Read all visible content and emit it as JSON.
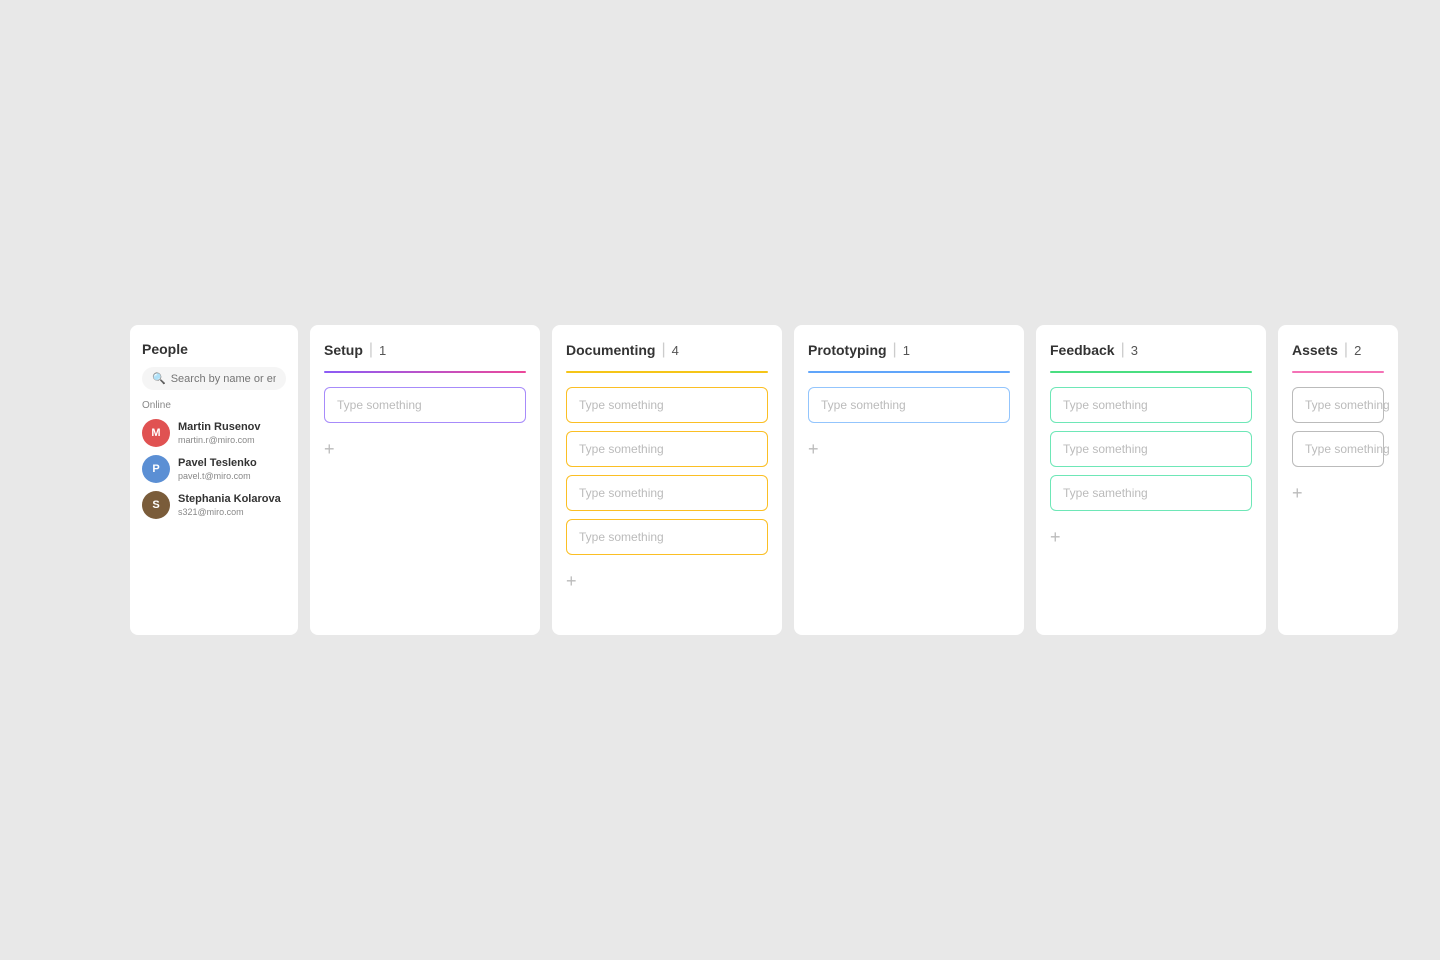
{
  "people": {
    "title": "People",
    "search_placeholder": "Search by name or email",
    "online_label": "Online",
    "users": [
      {
        "name": "Martin Rusenov",
        "email": "martin.r@miro.com",
        "initials": "M",
        "color": "avatar-m"
      },
      {
        "name": "Pavel Teslenko",
        "email": "pavel.t@miro.com",
        "initials": "P",
        "color": "avatar-p"
      },
      {
        "name": "Stephania Kolarova",
        "email": "s321@miro.com",
        "initials": "S",
        "color": "avatar-s"
      }
    ]
  },
  "columns": [
    {
      "id": "setup",
      "title": "Setup",
      "count": "1",
      "line_class": "line-purple",
      "border_class": "border-purple",
      "cards": [
        {
          "placeholder": "Type something"
        }
      ]
    },
    {
      "id": "documenting",
      "title": "Documenting",
      "count": "4",
      "line_class": "line-yellow",
      "border_class": "border-yellow",
      "cards": [
        {
          "placeholder": "Type something"
        },
        {
          "placeholder": "Type something"
        },
        {
          "placeholder": "Type something"
        },
        {
          "placeholder": "Type something"
        }
      ]
    },
    {
      "id": "prototyping",
      "title": "Prototyping",
      "count": "1",
      "line_class": "line-blue",
      "border_class": "border-blue",
      "cards": [
        {
          "placeholder": "Type something"
        }
      ]
    },
    {
      "id": "feedback",
      "title": "Feedback",
      "count": "3",
      "line_class": "line-green",
      "border_class": "border-green",
      "cards": [
        {
          "placeholder": "Type something"
        },
        {
          "placeholder": "Type something"
        },
        {
          "placeholder": "Type samething"
        }
      ]
    }
  ],
  "assets": {
    "title": "Assets",
    "count": "2",
    "line_class": "line-pink",
    "border_class": "border-pink",
    "cards": [
      {
        "placeholder": "Type something"
      },
      {
        "placeholder": "Type something"
      }
    ]
  },
  "add_label": "+",
  "divider": "|"
}
